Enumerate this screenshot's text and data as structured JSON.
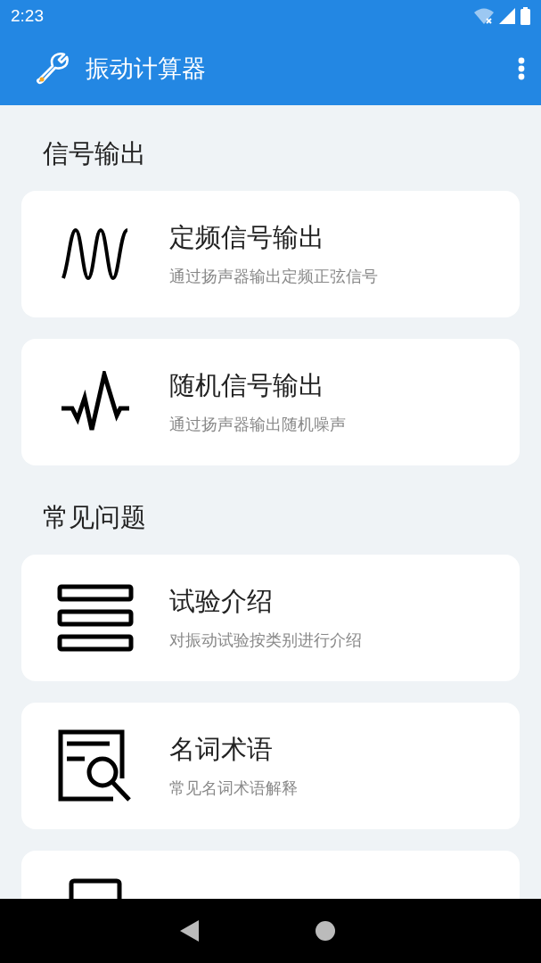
{
  "status_bar": {
    "time": "2:23"
  },
  "app_bar": {
    "title": "振动计算器"
  },
  "sections": [
    {
      "title": "信号输出",
      "items": [
        {
          "kind": "sine",
          "title": "定频信号输出",
          "subtitle": "通过扬声器输出定频正弦信号"
        },
        {
          "kind": "noise",
          "title": "随机信号输出",
          "subtitle": "通过扬声器输出随机噪声"
        }
      ]
    },
    {
      "title": "常见问题",
      "items": [
        {
          "kind": "list",
          "title": "试验介绍",
          "subtitle": "对振动试验按类别进行介绍"
        },
        {
          "kind": "lookup",
          "title": "名词术语",
          "subtitle": "常见名词术语解释"
        },
        {
          "kind": "doc"
        }
      ]
    }
  ]
}
